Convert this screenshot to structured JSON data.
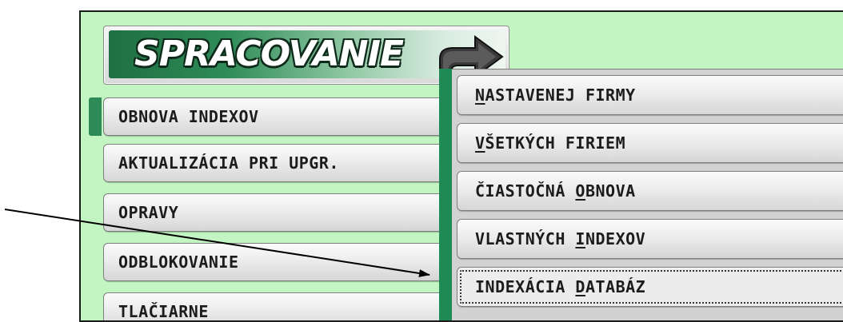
{
  "header": {
    "title": "SPRACOVANIE"
  },
  "left_menu": {
    "items": [
      {
        "label": "OBNOVA INDEXOV",
        "selected": true
      },
      {
        "label": "AKTUALIZÁCIA PRI UPGR."
      },
      {
        "label": "OPRAVY"
      },
      {
        "label": "ODBLOKOVANIE"
      },
      {
        "label": "TLAČIARNE"
      }
    ]
  },
  "submenu": {
    "items": [
      {
        "pre": "",
        "hotkey": "N",
        "post": "ASTAVENEJ FIRMY"
      },
      {
        "pre": "",
        "hotkey": "V",
        "post": "ŠETKÝCH FIRIEM"
      },
      {
        "pre": "ČIASTOČNÁ ",
        "hotkey": "O",
        "post": "BNOVA"
      },
      {
        "pre": "VLASTNÝCH ",
        "hotkey": "I",
        "post": "NDEXOV"
      },
      {
        "pre": "INDEXÁCIA ",
        "hotkey": "D",
        "post": "ATABÁZ",
        "active": true
      }
    ]
  },
  "colors": {
    "window_bg": "#c2f5c2",
    "accent_green": "#2e8b57",
    "button_text": "#1c1c1c"
  }
}
